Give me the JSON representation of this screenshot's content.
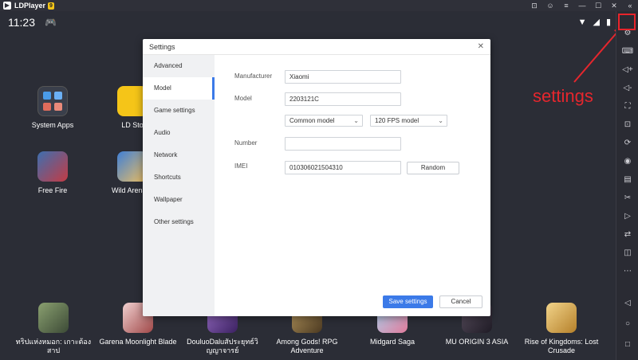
{
  "titlebar": {
    "logo_letter": "▶",
    "title": "LDPlayer",
    "badge": "9",
    "icons": [
      "gamepad-icon",
      "user-icon",
      "menu-icon",
      "minimize-icon",
      "maximize-icon",
      "close-icon",
      "collapse-icon"
    ],
    "icon_glyphs": [
      "⊡",
      "☺",
      "≡",
      "—",
      "☐",
      "✕",
      "«"
    ]
  },
  "statusbar": {
    "time": "11:23",
    "gamepad_glyph": "🎮",
    "wifi_glyph": "▼",
    "signal_glyph": "◢",
    "battery_glyph": "▮"
  },
  "desktop": {
    "apps": [
      {
        "label": "System Apps",
        "color": "#3a3f4b"
      },
      {
        "label": "LD Sto",
        "color": "#f5c518"
      },
      {
        "label": "Free Fire",
        "color": "#c33b44"
      },
      {
        "label": "Wild Arena S",
        "color": "#3f7fd6"
      }
    ],
    "dock": [
      {
        "label": "ทริปแห่งหมอก: เกาะต้องสาป",
        "color": "#5a6b4c"
      },
      {
        "label": "Garena Moonlight Blade",
        "color": "#c47d7d"
      },
      {
        "label": "DouluoDaluสัประยุทธ์วิญญาจารย์",
        "color": "#6a3f8f"
      },
      {
        "label": "Among Gods! RPG Adventure",
        "color": "#7c6440"
      },
      {
        "label": "Midgard Saga",
        "color": "#7db6e0"
      },
      {
        "label": "MU ORIGIN 3 ASIA",
        "color": "#2a2630"
      },
      {
        "label": "Rise of Kingdoms: Lost Crusade",
        "color": "#e2b24a"
      }
    ]
  },
  "annotation": {
    "text": "settings",
    "color": "#e5262d"
  },
  "dialog": {
    "title": "Settings",
    "close_glyph": "✕",
    "sidebar": [
      "Advanced",
      "Model",
      "Game settings",
      "Audio",
      "Network",
      "Shortcuts",
      "Wallpaper",
      "Other settings"
    ],
    "active_index": 1,
    "form": {
      "manufacturer_label": "Manufacturer",
      "manufacturer_value": "Xiaomi",
      "model_label": "Model",
      "model_value": "2203121C",
      "model_select": "Common model",
      "fps_select": "120 FPS model",
      "number_label": "Number",
      "number_value": "",
      "imei_label": "IMEI",
      "imei_value": "010306021504310",
      "random_label": "Random"
    },
    "save_label": "Save settings",
    "cancel_label": "Cancel"
  },
  "right_toolbar": {
    "icons": [
      "settings-icon",
      "keyboard-icon",
      "volume-up-icon",
      "volume-down-icon",
      "fullscreen-icon",
      "screenshot-icon",
      "rotate-icon",
      "record-icon",
      "apk-icon",
      "scissors-icon",
      "video-icon",
      "sync-icon",
      "shake-icon",
      "more-icon"
    ],
    "glyphs": [
      "⚙",
      "⌨",
      "◁+",
      "◁-",
      "⛶",
      "⊡",
      "⟳",
      "◉",
      "▤",
      "✂",
      "▷",
      "⇄",
      "◫",
      "⋯"
    ],
    "nav_glyphs": [
      "◁",
      "○",
      "□"
    ]
  },
  "accent": "#3b7ae8"
}
